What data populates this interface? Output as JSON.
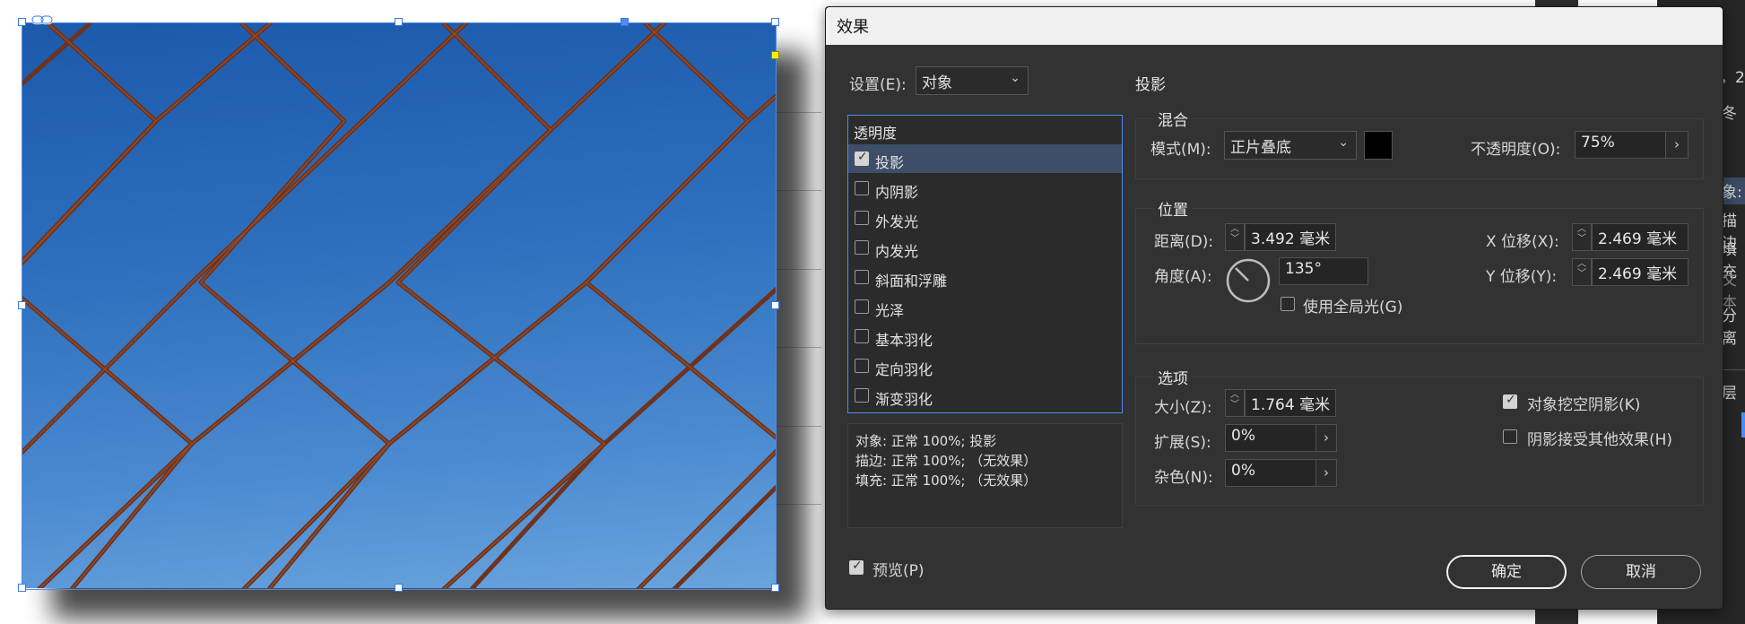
{
  "dialog": {
    "title": "效果",
    "settings_label": "设置(E):",
    "settings_value": "对象",
    "section_title": "投影",
    "effects_header": "透明度",
    "effects": [
      {
        "label": "投影",
        "checked": true,
        "selected": true
      },
      {
        "label": "内阴影",
        "checked": false,
        "selected": false
      },
      {
        "label": "外发光",
        "checked": false,
        "selected": false
      },
      {
        "label": "内发光",
        "checked": false,
        "selected": false
      },
      {
        "label": "斜面和浮雕",
        "checked": false,
        "selected": false
      },
      {
        "label": "光泽",
        "checked": false,
        "selected": false
      },
      {
        "label": "基本羽化",
        "checked": false,
        "selected": false
      },
      {
        "label": "定向羽化",
        "checked": false,
        "selected": false
      },
      {
        "label": "渐变羽化",
        "checked": false,
        "selected": false
      }
    ],
    "summary": [
      "对象: 正常 100%; 投影",
      "描边: 正常 100%; （无效果）",
      "填充: 正常 100%; （无效果）"
    ],
    "blend": {
      "title": "混合",
      "mode_label": "模式(M):",
      "mode_value": "正片叠底",
      "color": "#000000",
      "opacity_label": "不透明度(O):",
      "opacity_value": "75%"
    },
    "position": {
      "title": "位置",
      "distance_label": "距离(D):",
      "distance_value": "3.492 毫米",
      "angle_label": "角度(A):",
      "angle_value": "135°",
      "global_light_label": "使用全局光(G)",
      "global_light_checked": false,
      "x_offset_label": "X 位移(X):",
      "x_offset_value": "2.469 毫米",
      "y_offset_label": "Y 位移(Y):",
      "y_offset_value": "2.469 毫米"
    },
    "options": {
      "title": "选项",
      "size_label": "大小(Z):",
      "size_value": "1.764 毫米",
      "spread_label": "扩展(S):",
      "spread_value": "0%",
      "noise_label": "杂色(N):",
      "noise_value": "0%",
      "knockout_label": "对象挖空阴影(K)",
      "knockout_checked": true,
      "honor_effects_label": "阴影接受其他效果(H)",
      "honor_effects_checked": false
    },
    "preview_label": "预览(P)",
    "preview_checked": true,
    "ok_label": "确定",
    "cancel_label": "取消"
  },
  "side_panel": {
    "items": [
      "，2",
      "冬",
      "象:",
      "描边",
      "填充",
      "文本",
      "分离",
      "层"
    ]
  },
  "colors": {
    "accent": "#4d8cf2",
    "dialog_bg": "#323232",
    "sky_top": "#1c59ab",
    "sky_bottom": "#6aa4dd",
    "fence": "#7a3a22"
  },
  "icons": [
    "link-icon",
    "checkbox-icon",
    "chevron-down-icon",
    "chevron-right-icon",
    "spinner-icon",
    "angle-dial-icon"
  ]
}
